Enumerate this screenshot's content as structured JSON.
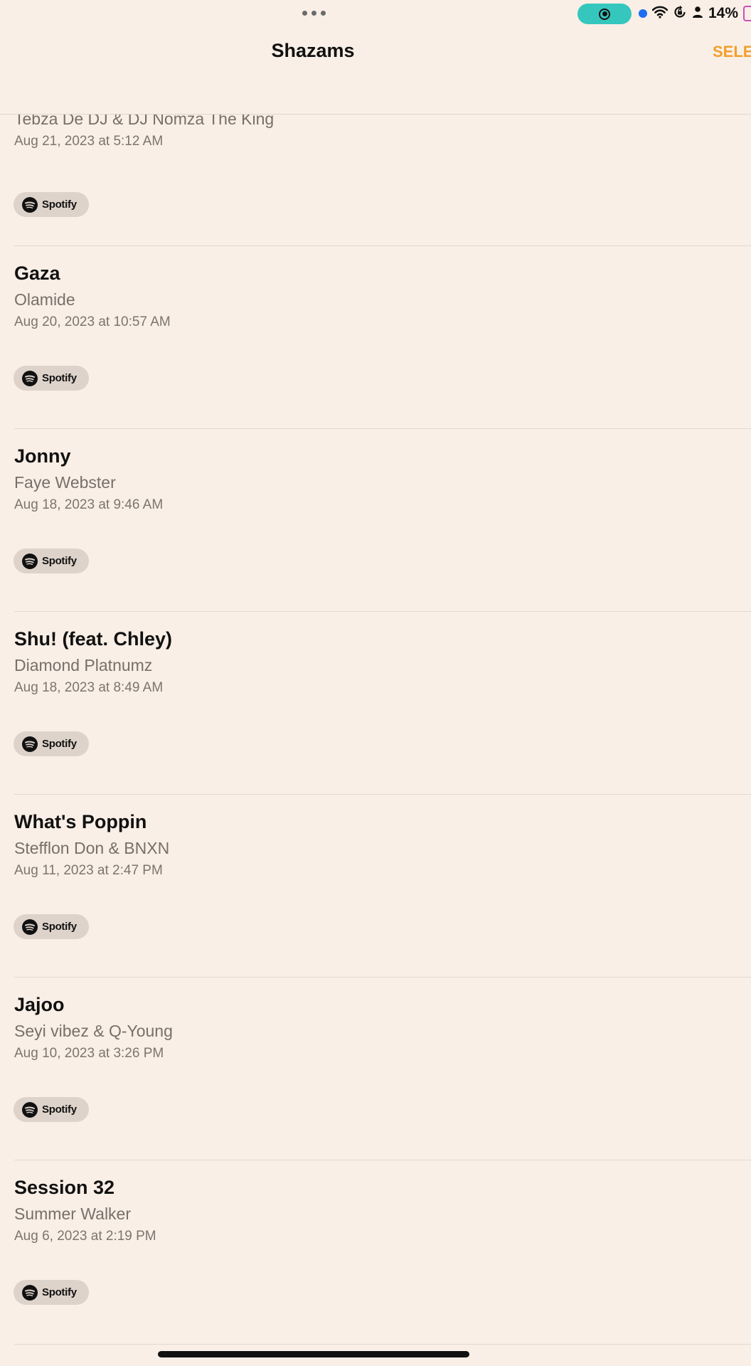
{
  "status_bar": {
    "battery_percent": "14%",
    "accent_recording": "#35c7be",
    "icons": [
      "multitask-dots-icon",
      "screen-record-icon",
      "mic-indicator-icon",
      "wifi-icon",
      "rotation-lock-icon",
      "person-icon",
      "battery-icon"
    ]
  },
  "nav": {
    "title": "Shazams",
    "select_label": "SELECT"
  },
  "partial_item": {
    "artist": "Tebza De DJ & DJ Nomza The King",
    "date": "Aug 21, 2023 at 5:12 AM",
    "spotify_label": "Spotify"
  },
  "items": [
    {
      "title": "Gaza",
      "artist": "Olamide",
      "date": "Aug 20, 2023 at 10:57 AM",
      "spotify_label": "Spotify"
    },
    {
      "title": "Jonny",
      "artist": "Faye Webster",
      "date": "Aug 18, 2023 at 9:46 AM",
      "spotify_label": "Spotify"
    },
    {
      "title": "Shu! (feat. Chley)",
      "artist": "Diamond Platnumz",
      "date": "Aug 18, 2023 at 8:49 AM",
      "spotify_label": "Spotify"
    },
    {
      "title": "What's Poppin",
      "artist": "Stefflon Don & BNXN",
      "date": "Aug 11, 2023 at 2:47 PM",
      "spotify_label": "Spotify"
    },
    {
      "title": "Jajoo",
      "artist": "Seyi vibez & Q-Young",
      "date": "Aug 10, 2023 at 3:26 PM",
      "spotify_label": "Spotify"
    },
    {
      "title": "Session 32",
      "artist": "Summer Walker",
      "date": "Aug 6, 2023 at 2:19 PM",
      "spotify_label": "Spotify"
    }
  ],
  "colors": {
    "background": "#f9efe6",
    "accent": "#f29f2c",
    "spotify_button": "#ddd3ca"
  }
}
